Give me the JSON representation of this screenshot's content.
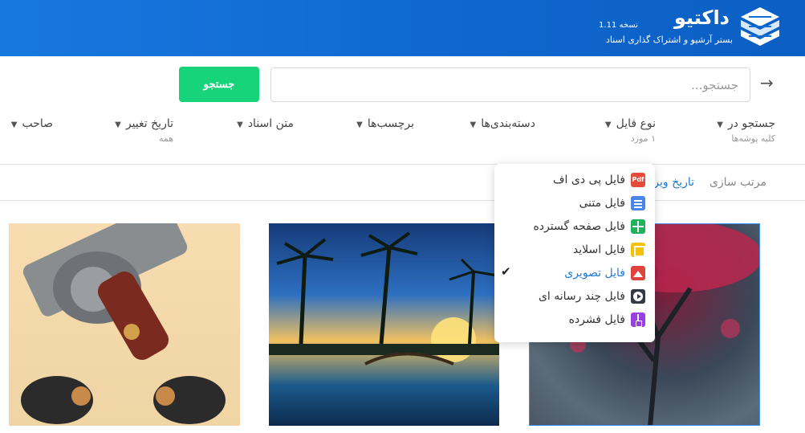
{
  "header": {
    "brand_name": "داکتیو",
    "version": "نسخه 1.11",
    "tagline": "بستر آرشیو و اشتراک گذاری اسناد",
    "background_color": "#1470d8"
  },
  "search": {
    "placeholder": "جستجو...",
    "value": "",
    "button_label": "جستجو",
    "button_color": "#17d37a"
  },
  "filters": [
    {
      "label": "جستجو در",
      "sub": "کلیه پوشه‌ها"
    },
    {
      "label": "نوع فایل",
      "sub": "۱ مورد"
    },
    {
      "label": "دسته‌بندی‌ها",
      "sub": ""
    },
    {
      "label": "برچسب‌ها",
      "sub": ""
    },
    {
      "label": "متن اسناد",
      "sub": ""
    },
    {
      "label": "تاریخ تغییر",
      "sub": "همه"
    },
    {
      "label": "صاحب",
      "sub": ""
    }
  ],
  "sort": {
    "label": "مرتب سازی",
    "value": "تاریخ ویرا"
  },
  "file_type_menu": [
    {
      "label": "فایل پی دی اف",
      "icon": "pdf-icon",
      "icon_text": "Pdf",
      "selected": false
    },
    {
      "label": "فایل متنی",
      "icon": "document-icon",
      "selected": false
    },
    {
      "label": "فایل صفحه گسترده",
      "icon": "spreadsheet-icon",
      "selected": false
    },
    {
      "label": "فایل اسلاید",
      "icon": "slides-icon",
      "selected": false
    },
    {
      "label": "فایل تصویری",
      "icon": "image-icon",
      "selected": true
    },
    {
      "label": "فایل چند رسانه ای",
      "icon": "media-icon",
      "selected": false
    },
    {
      "label": "فایل فشرده",
      "icon": "zip-icon",
      "selected": false
    }
  ],
  "colors": {
    "accent": "#1e7bd8",
    "selected_card_border": "#3d8ef0"
  },
  "results": [
    {
      "image": "revolver-photo"
    },
    {
      "image": "palm-sunset-photo"
    },
    {
      "image": "red-tree-photo"
    }
  ]
}
